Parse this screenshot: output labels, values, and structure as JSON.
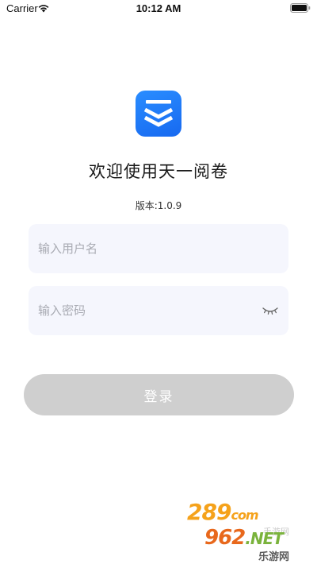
{
  "status_bar": {
    "carrier": "Carrier",
    "time": "10:12 AM"
  },
  "app": {
    "logo_icon": "app-logo-icon",
    "brand_color": "#1d7bf7",
    "welcome_title": "欢迎使用天一阅卷",
    "version_text": "版本:1.0.9"
  },
  "form": {
    "username_placeholder": "输入用户名",
    "username_value": "",
    "password_placeholder": "输入密码",
    "password_value": "",
    "password_toggle_icon": "eye-closed-icon",
    "login_label": "登录",
    "login_disabled_color": "#cfcfcf"
  },
  "watermark": {
    "top": "289",
    "top_suffix": "com",
    "bottom": "962",
    "bottom_suffix": ".NET",
    "ghost_cn": "手游网",
    "cn": "乐游网"
  }
}
